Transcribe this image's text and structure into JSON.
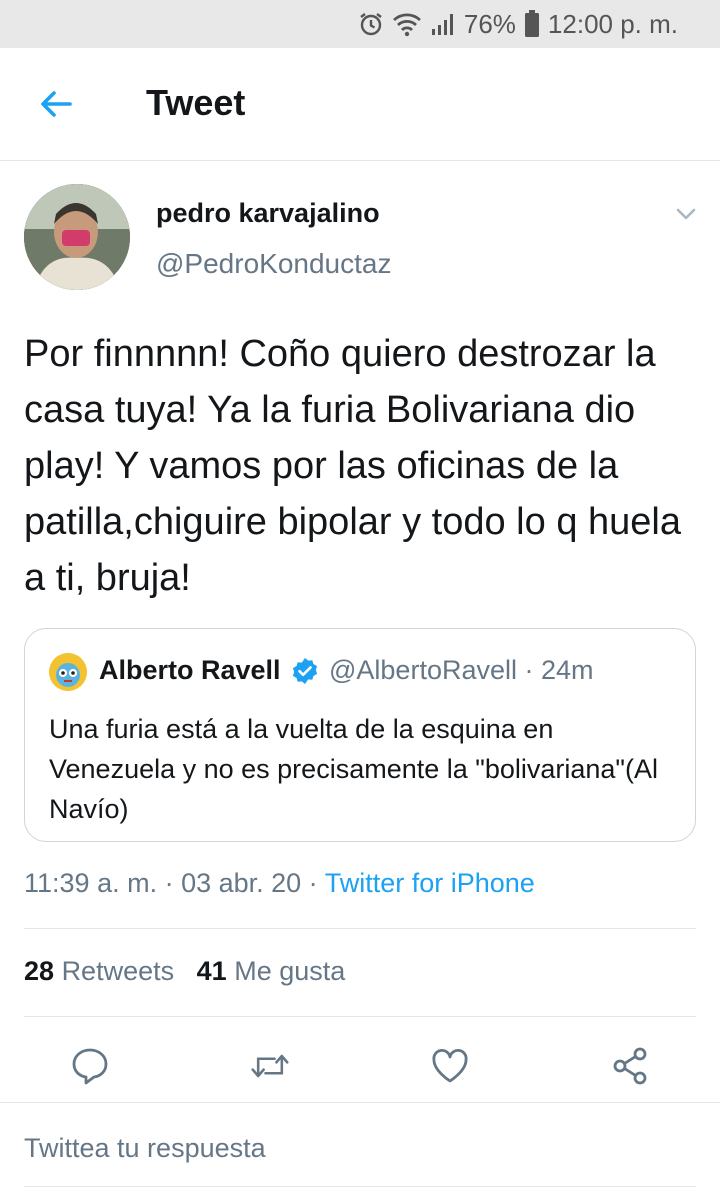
{
  "status_bar": {
    "battery": "76%",
    "time": "12:00 p. m.",
    "icons": [
      "alarm-icon",
      "wifi-icon",
      "signal-icon",
      "battery-icon"
    ]
  },
  "header": {
    "title": "Tweet",
    "back_icon": "arrow-left-icon"
  },
  "tweet": {
    "author_name": "pedro karvajalino",
    "author_handle": "@PedroKonductaz",
    "text": "Por finnnnn! Coño quiero destrozar la casa tuya! Ya la furia Bolivariana dio play! Y vamos por las oficinas de la patilla,chiguire bipolar y todo lo q huela a ti, bruja!",
    "timestamp": "11:39 a. m. · 03 abr. 20 · ",
    "source": "Twitter for iPhone",
    "retweets_count": "28",
    "retweets_label": "Retweets",
    "likes_count": "41",
    "likes_label": "Me gusta"
  },
  "quote": {
    "author_name": "Alberto Ravell",
    "meta": "@AlbertoRavell · 24m",
    "text": "Una furia está a la vuelta de la esquina en Venezuela y no es precisamente la \"bolivariana\"(Al Navío)"
  },
  "actions": [
    "reply-icon",
    "retweet-icon",
    "like-icon",
    "share-icon"
  ],
  "reply": {
    "placeholder": "Twittea tu respuesta"
  },
  "colors": {
    "accent": "#1da1f2",
    "secondary_text": "#657786",
    "primary_text": "#14171a",
    "status_bar_bg": "#e8e8e8"
  }
}
